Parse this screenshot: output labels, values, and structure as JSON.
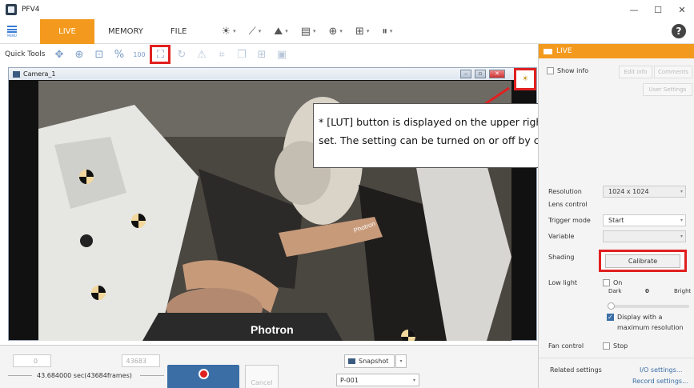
{
  "window": {
    "title": "PFV4",
    "minimize": "—",
    "maximize": "☐",
    "close": "✕"
  },
  "menu": {
    "menu_label": "MENU",
    "tabs": [
      "LIVE",
      "MEMORY",
      "FILE"
    ],
    "help": "?"
  },
  "quick_tools": {
    "label": "Quick Tools",
    "percent_label": "%",
    "hundred_label": "100"
  },
  "camera": {
    "title": "Camera_1",
    "minimize": "–",
    "restore": "▫",
    "close": "✕",
    "lut_icon": "☀"
  },
  "scene_text": {
    "dummy_label": "Photron",
    "seat_label": "Photron"
  },
  "annotation": {
    "text": "* [LUT] button is displayed on the upper right of the screen if the LUT is set. The setting can be turned on or off by clicking the button."
  },
  "panel": {
    "header": "LIVE",
    "show_info": "Show info",
    "edit_info": "Edit info",
    "comments": "Comments",
    "user_settings": "User Settings",
    "resolution_label": "Resolution",
    "resolution_value": "1024 x 1024",
    "lens_control": "Lens control",
    "trigger_mode_label": "Trigger mode",
    "trigger_mode_value": "Start",
    "variable_label": "Variable",
    "variable_value": "",
    "shading_label": "Shading",
    "calibrate": "Calibrate",
    "low_light_label": "Low light",
    "low_light_on": "On",
    "dark": "Dark",
    "low_light_value": "0",
    "bright": "Bright",
    "display_max": "Display with a maximum resolution",
    "fan_control_label": "Fan control",
    "fan_stop": "Stop",
    "related_settings": "Related settings",
    "io_settings": "I/O settings...",
    "record_settings": "Record settings..."
  },
  "bottom": {
    "start_frame": "0",
    "end_frame": "43683",
    "duration": "43.684000 sec(43684frames)",
    "cancel": "Cancel",
    "snapshot": "Snapshot",
    "snapshot_name": "P-001"
  }
}
